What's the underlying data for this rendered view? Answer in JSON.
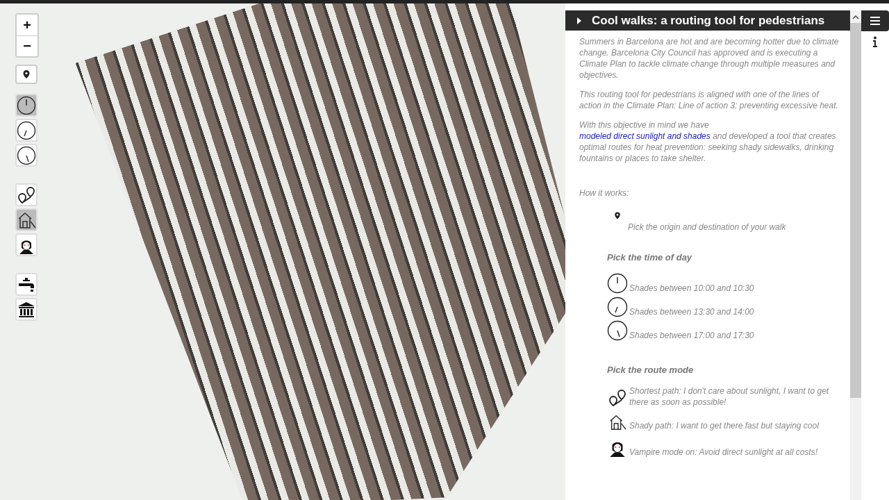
{
  "map_controls": {
    "zoom": [
      "+",
      "−"
    ],
    "time_buttons": [
      {
        "kind": "morning",
        "selected": true
      },
      {
        "kind": "afternoon",
        "selected": false
      },
      {
        "kind": "evening",
        "selected": false
      }
    ],
    "mode_buttons": [
      {
        "kind": "shortest",
        "selected": false
      },
      {
        "kind": "shady",
        "selected": true
      },
      {
        "kind": "vampire",
        "selected": false
      }
    ],
    "layer_buttons": [
      {
        "kind": "fountain"
      },
      {
        "kind": "shelter"
      }
    ]
  },
  "panel": {
    "title": "Cool walks: a routing tool for pedestrians",
    "paragraphs": [
      {
        "text": "Summers in Barcelona are hot and are becoming hotter due to climate change. Barcelona City Council has approved and is executing a Climate Plan to tackle climate change through multiple measures and objectives."
      },
      {
        "text": "This routing tool for pedestrians is aligned with one of the lines of action in the Climate Plan: Line of action 3: preventing excessive heat."
      },
      {
        "text": "With this objective in mind we have ",
        "link": "modeled direct sunlight and shades",
        "after": " and developed a tool that creates optimal routes for heat prevention: seeking shady sidewalks, drinking fountains or places to take shelter."
      }
    ],
    "how_it_works": "How it works:",
    "origin_step": "Pick the origin and destination of your walk",
    "time_heading": "Pick the time of day",
    "time_options": [
      {
        "kind": "morning",
        "text": "Shades between 10:00 and 10:30"
      },
      {
        "kind": "afternoon",
        "text": "Shades between 13:30 and 14:00"
      },
      {
        "kind": "evening",
        "text": "Shades between 17:00 and 17:30"
      }
    ],
    "mode_heading": "Pick the route mode",
    "mode_options": [
      {
        "kind": "shortest",
        "text": "Shortest path: I don't care about sunlight, I want to get there as soon as possible!"
      },
      {
        "kind": "shady",
        "text": "Shady path: I want to get there fast but staying cool"
      },
      {
        "kind": "vampire",
        "text": "Vampire mode on: Avoid direct sunlight at all costs!"
      }
    ]
  },
  "sidebar_tabs": [
    {
      "kind": "menu",
      "selected": true
    },
    {
      "kind": "info",
      "selected": false
    }
  ]
}
